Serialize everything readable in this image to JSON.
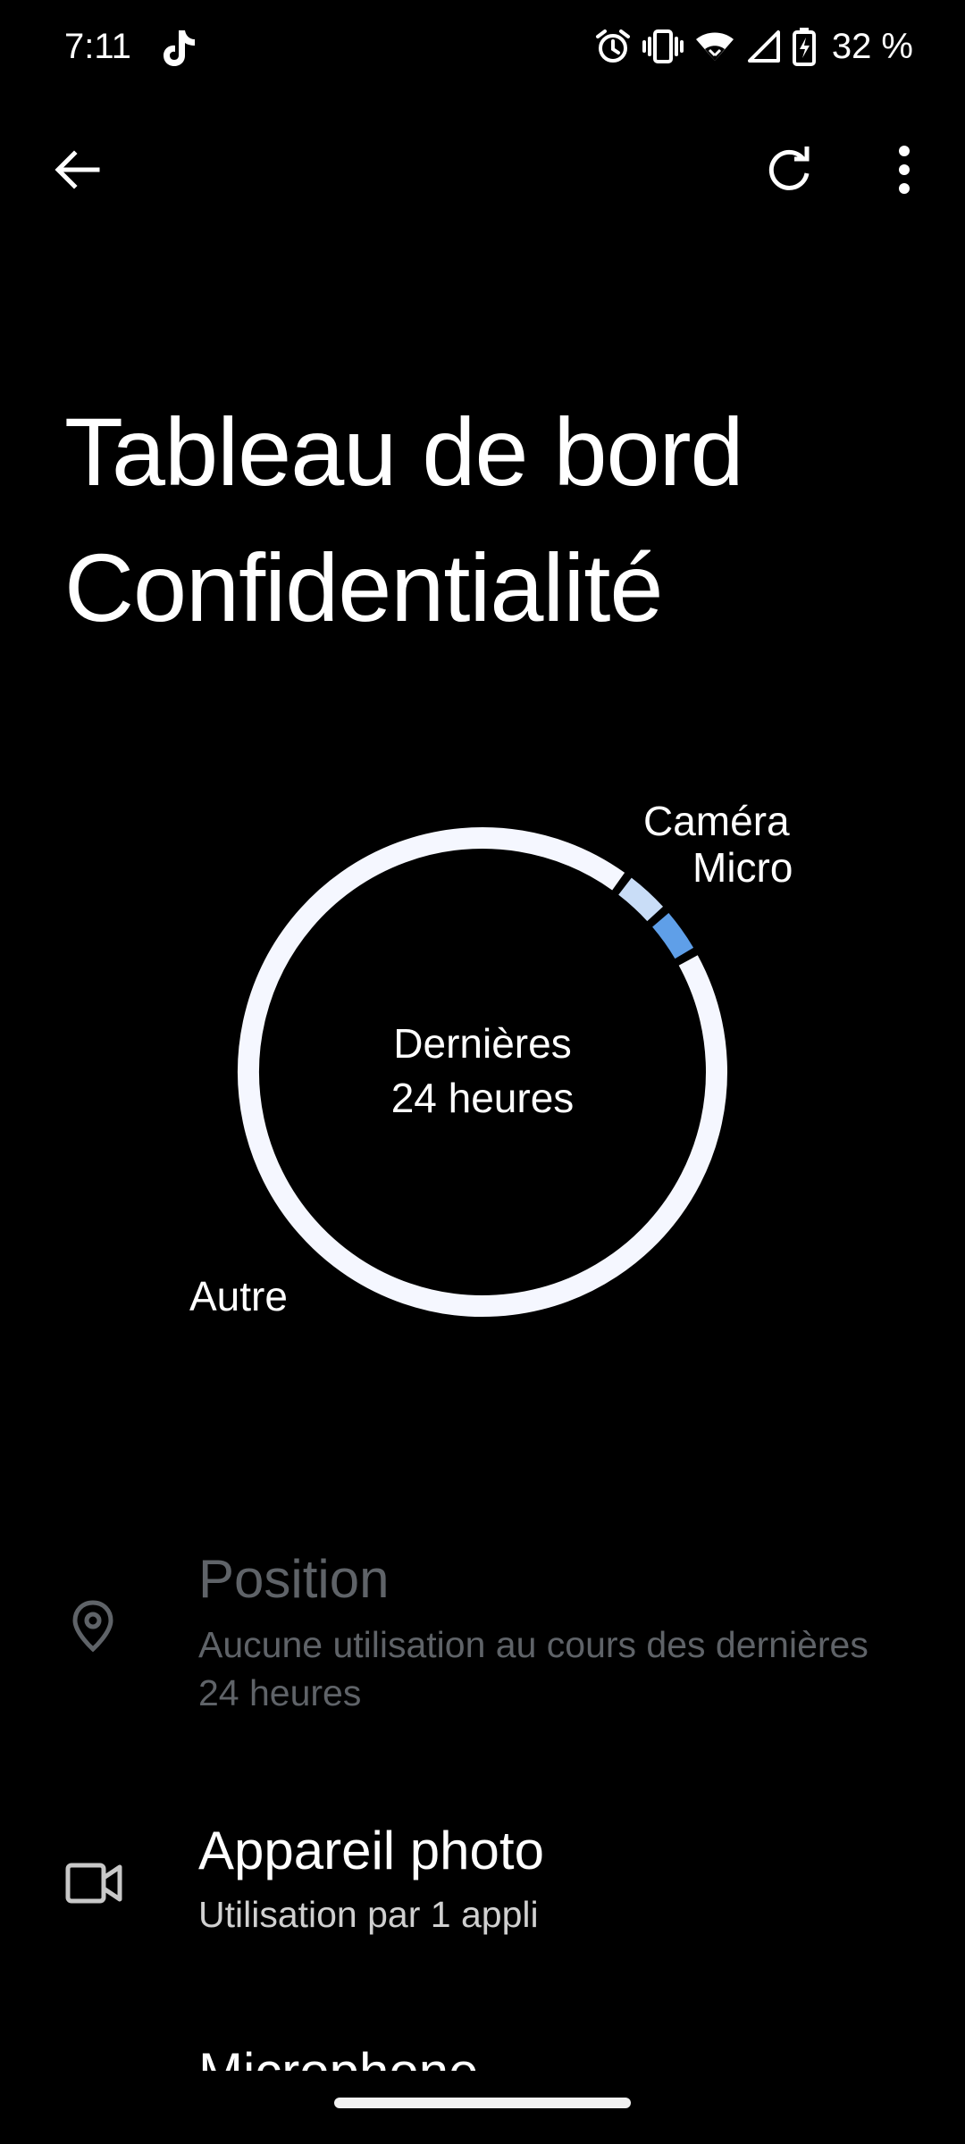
{
  "status_bar": {
    "time": "7:11",
    "battery": "32 %",
    "icons": [
      "tiktok-icon",
      "alarm-icon",
      "vibrate-icon",
      "wifi-icon",
      "signal-icon",
      "battery-charging-icon"
    ]
  },
  "toolbar": {
    "icons": [
      "back-arrow-icon",
      "refresh-icon",
      "more-vert-icon"
    ]
  },
  "page": {
    "title_line1": "Tableau de bord",
    "title_line2": "Confidentialité"
  },
  "chart_data": {
    "type": "pie",
    "center_line1": "Dernières",
    "center_line2": "24 heures",
    "labels": [
      "Caméra",
      "Micro",
      "Autre"
    ],
    "colors": {
      "Caméra": "#c9ddf7",
      "Micro": "#5f9fe8",
      "Autre": "#f5f7ff"
    }
  },
  "list": {
    "items": [
      {
        "icon": "location-pin-icon",
        "title": "Position",
        "subtitle_line1": "Aucune utilisation au cours des dernières",
        "subtitle_line2": "24 heures"
      },
      {
        "icon": "videocam-icon",
        "title": "Appareil photo",
        "subtitle_line1": "Utilisation par 1 appli"
      },
      {
        "icon": "microphone-icon",
        "title": "Microphone"
      }
    ]
  },
  "colors": {
    "background": "#000000",
    "text": "#ffffff",
    "disabled_text": "#5f6368",
    "accent_blue": "#5f9fe8",
    "ring": "#f5f7ff"
  }
}
